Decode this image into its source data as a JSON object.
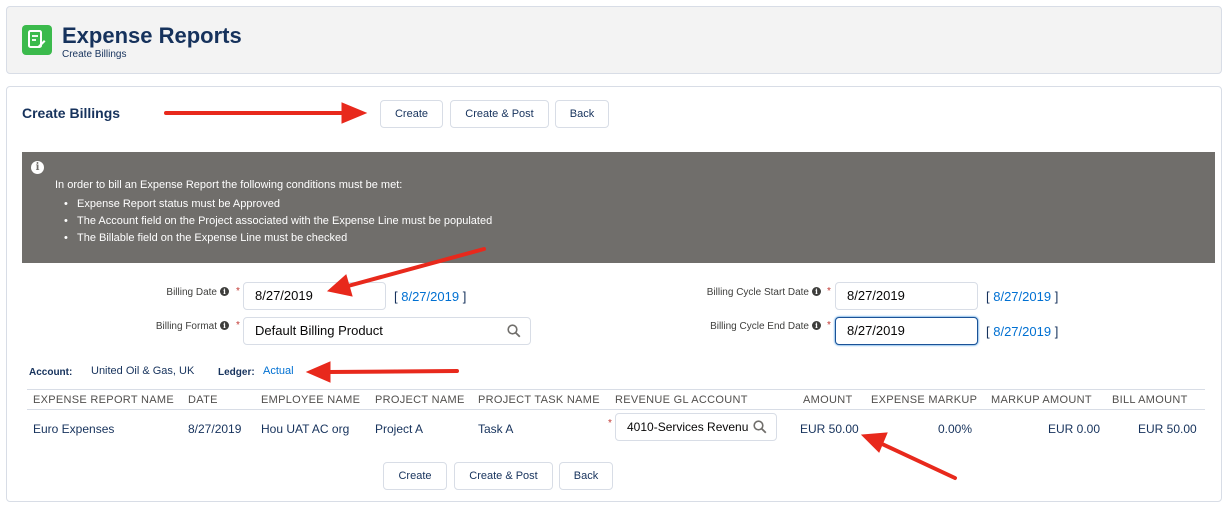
{
  "header": {
    "app_title": "Expense Reports",
    "app_subtitle": "Create Billings",
    "app_icon": "expense-report-icon",
    "brand_color": "#3bba4c"
  },
  "main": {
    "section_title": "Create Billings",
    "top_buttons": {
      "create": "Create",
      "create_post": "Create & Post",
      "back": "Back"
    },
    "info": {
      "intro": "In order to bill an Expense Report the following conditions must be met:",
      "items": [
        "Expense Report status must be Approved",
        "The Account field on the Project associated with the Expense Line must be populated",
        "The Billable field on the Expense Line must be checked"
      ],
      "background": "#706e6b"
    },
    "form": {
      "billing_date_label": "Billing Date",
      "billing_date_value": "8/27/2019",
      "billing_date_link": "8/27/2019",
      "billing_format_label": "Billing Format",
      "billing_format_value": "Default Billing Product",
      "cycle_start_label": "Billing Cycle Start Date",
      "cycle_start_value": "8/27/2019",
      "cycle_start_link": "8/27/2019",
      "cycle_end_label": "Billing Cycle End Date",
      "cycle_end_value": "8/27/2019",
      "cycle_end_link": "8/27/2019"
    },
    "account_label": "Account:",
    "account_value": "United Oil & Gas, UK",
    "ledger_label": "Ledger:",
    "ledger_value": "Actual",
    "table": {
      "headers": [
        "EXPENSE REPORT NAME",
        "DATE",
        "EMPLOYEE NAME",
        "PROJECT NAME",
        "PROJECT TASK NAME",
        "REVENUE GL ACCOUNT",
        "AMOUNT",
        "EXPENSE MARKUP",
        "MARKUP AMOUNT",
        "BILL AMOUNT"
      ],
      "rows": [
        {
          "expense_report_name": "Euro Expenses",
          "date": "8/27/2019",
          "employee_name": "Hou UAT AC org",
          "project_name": "Project A",
          "project_task_name": "Task A",
          "revenue_gl_account": "4010-Services Revenu",
          "amount": "EUR 50.00",
          "expense_markup": "0.00%",
          "markup_amount": "EUR 0.00",
          "bill_amount": "EUR 50.00"
        }
      ]
    },
    "bottom_buttons": {
      "create": "Create",
      "create_post": "Create & Post",
      "back": "Back"
    }
  },
  "colors": {
    "link": "#0070d2",
    "required": "#c23934",
    "annotation_arrow": "#e8291c"
  }
}
